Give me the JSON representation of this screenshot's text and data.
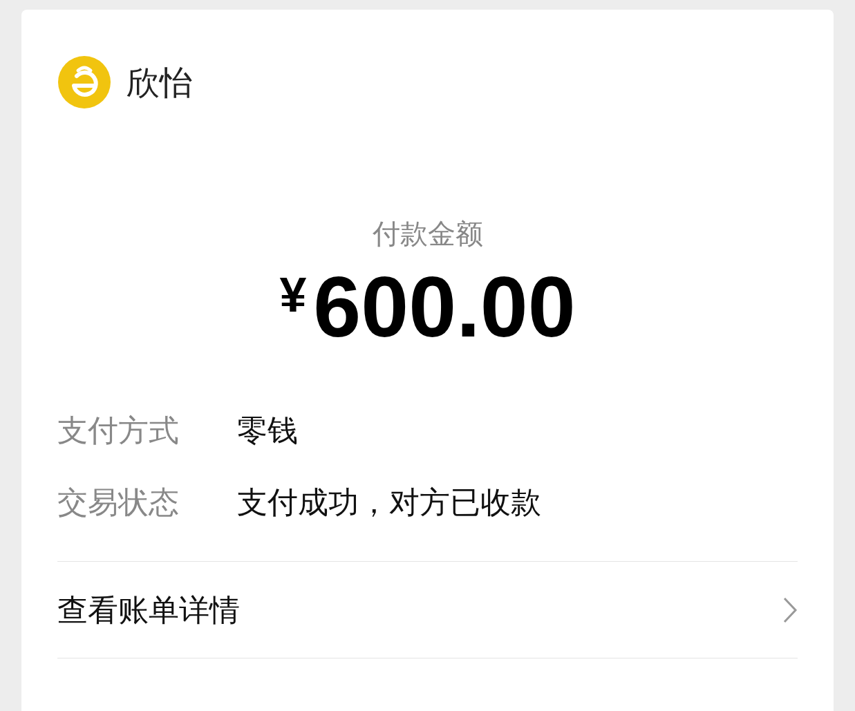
{
  "payee": {
    "name": "欣怡"
  },
  "amount": {
    "label": "付款金额",
    "currency": "¥",
    "value": "600.00"
  },
  "details": [
    {
      "label": "支付方式",
      "value": "零钱"
    },
    {
      "label": "交易状态",
      "value": "支付成功，对方已收款"
    }
  ],
  "links": [
    {
      "label": "查看账单详情"
    }
  ]
}
